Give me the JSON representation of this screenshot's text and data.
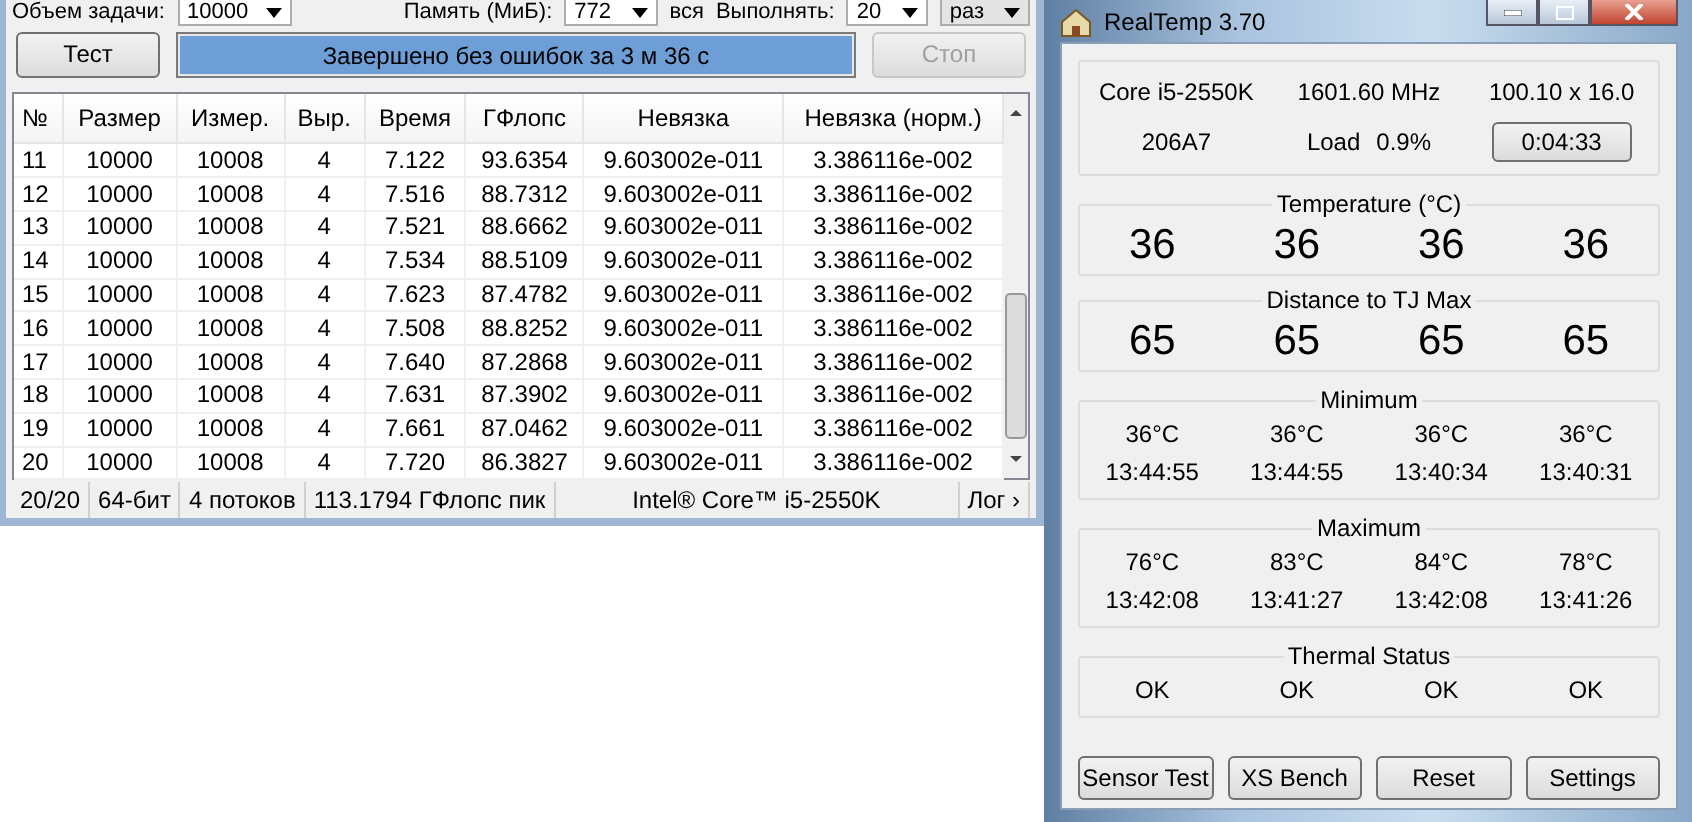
{
  "benchmark": {
    "top_bar": {
      "size_label": "Объем задачи:",
      "size": "10000",
      "memory_label": "Память (МиБ):",
      "memory": "772",
      "memory_note": "вся",
      "runs_label": "Выполнять:",
      "runs": "20",
      "runs_unit": "раз"
    },
    "test_button": "Тест",
    "progress": {
      "text": "Завершено без ошибок за 3 м 36 с",
      "level": 1
    },
    "stop_button": {
      "label": "Стоп",
      "disabled": true
    },
    "table": {
      "columns": [
        "№",
        "Размер",
        "Измер.",
        "Выр.",
        "Время",
        "ГФлопс",
        "Невязка",
        "Невязка (норм.)"
      ],
      "rows": [
        [
          "11",
          "10000",
          "10008",
          "4",
          "7.122",
          "93.6354",
          "9.603002e-011",
          "3.386116e-002"
        ],
        [
          "12",
          "10000",
          "10008",
          "4",
          "7.516",
          "88.7312",
          "9.603002e-011",
          "3.386116e-002"
        ],
        [
          "13",
          "10000",
          "10008",
          "4",
          "7.521",
          "88.6662",
          "9.603002e-011",
          "3.386116e-002"
        ],
        [
          "14",
          "10000",
          "10008",
          "4",
          "7.534",
          "88.5109",
          "9.603002e-011",
          "3.386116e-002"
        ],
        [
          "15",
          "10000",
          "10008",
          "4",
          "7.623",
          "87.4782",
          "9.603002e-011",
          "3.386116e-002"
        ],
        [
          "16",
          "10000",
          "10008",
          "4",
          "7.508",
          "88.8252",
          "9.603002e-011",
          "3.386116e-002"
        ],
        [
          "17",
          "10000",
          "10008",
          "4",
          "7.640",
          "87.2868",
          "9.603002e-011",
          "3.386116e-002"
        ],
        [
          "18",
          "10000",
          "10008",
          "4",
          "7.631",
          "87.3902",
          "9.603002e-011",
          "3.386116e-002"
        ],
        [
          "19",
          "10000",
          "10008",
          "4",
          "7.661",
          "87.0462",
          "9.603002e-011",
          "3.386116e-002"
        ],
        [
          "20",
          "10000",
          "10008",
          "4",
          "7.720",
          "86.3827",
          "9.603002e-011",
          "3.386116e-002"
        ]
      ]
    },
    "status_bar": [
      "20/20",
      "64-бит",
      "4 потоков",
      "113.1794 ГФлопс пик",
      "Intel® Core™ i5-2550K",
      "Лог ›"
    ]
  },
  "realtemp": {
    "title": "RealTemp 3.70",
    "info": {
      "cpu": "Core i5-2550K",
      "frequency": "1601.60 MHz",
      "multiplier": "100.10 x 16.0",
      "cpuid": "206A7",
      "load_label": "Load",
      "load": "0.9%",
      "timer": "0:04:33"
    },
    "sections": [
      {
        "title": "Temperature (°C)",
        "kind": "big",
        "values": [
          "36",
          "36",
          "36",
          "36"
        ]
      },
      {
        "title": "Distance to TJ Max",
        "kind": "big",
        "values": [
          "65",
          "65",
          "65",
          "65"
        ]
      },
      {
        "title": "Minimum",
        "kind": "record",
        "values": [
          {
            "temp": "36°C",
            "time": "13:44:55"
          },
          {
            "temp": "36°C",
            "time": "13:44:55"
          },
          {
            "temp": "36°C",
            "time": "13:40:34"
          },
          {
            "temp": "36°C",
            "time": "13:40:31"
          }
        ]
      },
      {
        "title": "Maximum",
        "kind": "record",
        "values": [
          {
            "temp": "76°C",
            "time": "13:42:08"
          },
          {
            "temp": "83°C",
            "time": "13:41:27"
          },
          {
            "temp": "84°C",
            "time": "13:42:08"
          },
          {
            "temp": "78°C",
            "time": "13:41:26"
          }
        ]
      },
      {
        "title": "Thermal Status",
        "kind": "status",
        "values": [
          "OK",
          "OK",
          "OK",
          "OK"
        ]
      }
    ],
    "buttons": [
      "Sensor Test",
      "XS Bench",
      "Reset",
      "Settings"
    ]
  }
}
